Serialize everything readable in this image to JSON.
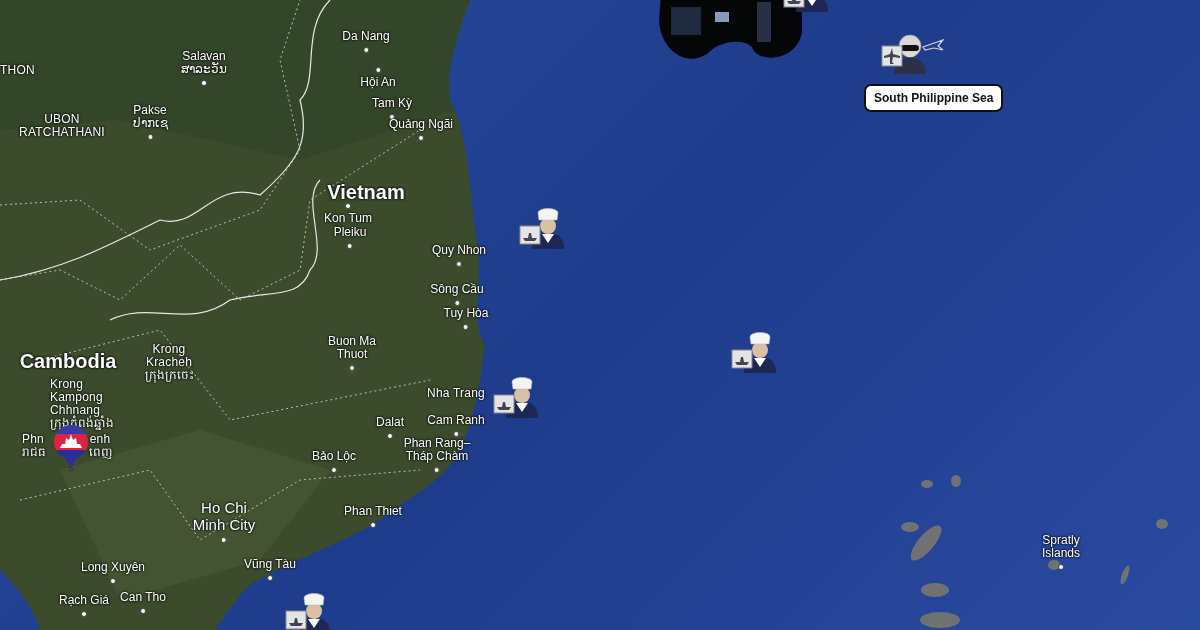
{
  "map": {
    "place_labels": [
      {
        "kind": "city",
        "name": "Da Nang"
      },
      {
        "kind": "area",
        "name": "THON"
      },
      {
        "kind": "city",
        "name": "Salavan",
        "native": "ສາລະວັນ"
      },
      {
        "kind": "city",
        "name": "Hội An"
      },
      {
        "kind": "city",
        "name": "Tam Kỳ"
      },
      {
        "kind": "city",
        "name": "Pakse",
        "native": "ປາກເຊ"
      },
      {
        "kind": "area",
        "name": "UBON\nRATCHATHANI"
      },
      {
        "kind": "city",
        "name": "Quảng Ngãi"
      },
      {
        "kind": "country",
        "name": "Vietnam"
      },
      {
        "kind": "city",
        "name": "Kon Tum"
      },
      {
        "kind": "city",
        "name": "Pleiku"
      },
      {
        "kind": "city",
        "name": "Quy Nhon"
      },
      {
        "kind": "city",
        "name": "Sông Cầu"
      },
      {
        "kind": "city",
        "name": "Tuy Hòa"
      },
      {
        "kind": "city",
        "name": "Buon Ma\nThuot"
      },
      {
        "kind": "country",
        "name": "Cambodia"
      },
      {
        "kind": "area",
        "name": "Krong\nKracheh",
        "native": "ក្រុងក្រចេះ"
      },
      {
        "kind": "area",
        "name": "Krong\nKampong\nChhnang",
        "native": "ក្រុងកំពង់ឆ្នាំង"
      },
      {
        "kind": "area",
        "name": "Nha Trang"
      },
      {
        "kind": "city",
        "name": "Cam Ranh"
      },
      {
        "kind": "city",
        "name": "Dalat"
      },
      {
        "kind": "area",
        "name": "Phn",
        "native": "រាជធ"
      },
      {
        "kind": "area",
        "name": "enh",
        "native": "ពេញ"
      },
      {
        "kind": "city",
        "name": "Bảo Lộc"
      },
      {
        "kind": "city",
        "name": "Phan Rang–\nTháp Chàm"
      },
      {
        "kind": "big",
        "name": "Ho Chi\nMinh City"
      },
      {
        "kind": "city",
        "name": "Phan Thiet"
      },
      {
        "kind": "city",
        "name": "Spratly\nIslands"
      },
      {
        "kind": "city",
        "name": "Vũng Tàu"
      },
      {
        "kind": "city",
        "name": "Long Xuyên"
      },
      {
        "kind": "city",
        "name": "Can Tho"
      },
      {
        "kind": "city",
        "name": "Rạch Giá"
      }
    ],
    "units": [
      {
        "kind": "sailor"
      },
      {
        "kind": "pilot"
      },
      {
        "kind": "sailor"
      },
      {
        "kind": "sailor"
      },
      {
        "kind": "sailor"
      },
      {
        "kind": "sailor"
      }
    ],
    "tooltip": {
      "text": "South Philippine Sea"
    }
  }
}
